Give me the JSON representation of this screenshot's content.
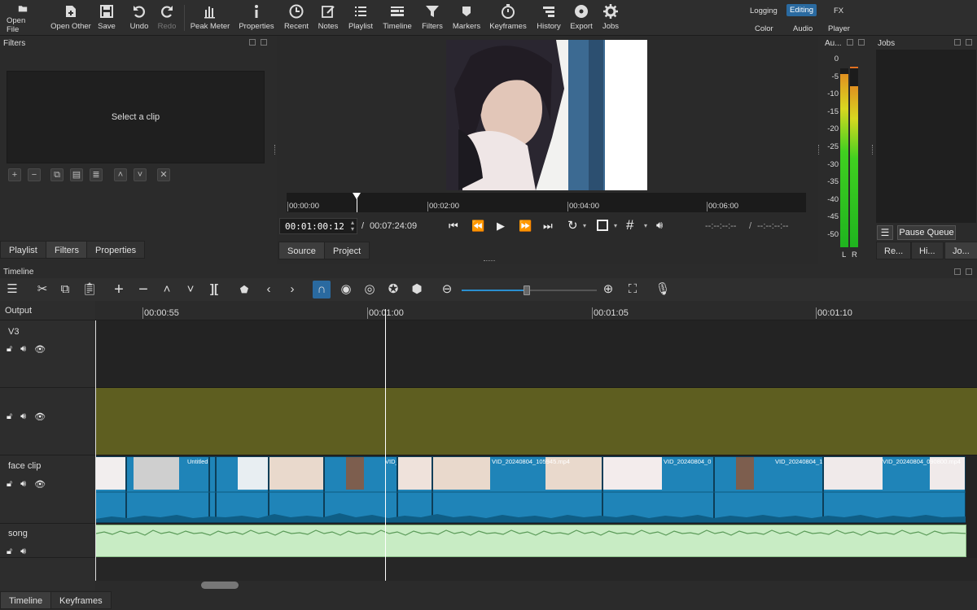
{
  "toolbar": {
    "open_file": "Open File",
    "open_other": "Open Other",
    "save": "Save",
    "undo": "Undo",
    "redo": "Redo",
    "peak_meter": "Peak Meter",
    "properties": "Properties",
    "recent": "Recent",
    "notes": "Notes",
    "playlist": "Playlist",
    "timeline": "Timeline",
    "filters": "Filters",
    "markers": "Markers",
    "keyframes": "Keyframes",
    "history": "History",
    "export": "Export",
    "jobs": "Jobs"
  },
  "layouts": {
    "logging": "Logging",
    "editing": "Editing",
    "fx": "FX",
    "color": "Color",
    "audio": "Audio",
    "player": "Player"
  },
  "filters_panel": {
    "title": "Filters",
    "placeholder": "Select a clip"
  },
  "left_tabs": {
    "playlist": "Playlist",
    "filters": "Filters",
    "properties": "Properties"
  },
  "player": {
    "ruler_labels": [
      "00:00:00",
      "00:02:00",
      "00:04:00",
      "00:06:00"
    ],
    "current_time": "00:01:00:12",
    "separator": "/",
    "total_time": "00:07:24:09",
    "in_point": "--:--:--:--",
    "out_point": "--:--:--:--",
    "tab_source": "Source",
    "tab_project": "Project"
  },
  "audio_meter": {
    "title": "Au...",
    "scale": [
      "0",
      "-5",
      "-10",
      "-15",
      "-20",
      "-25",
      "-30",
      "-35",
      "-40",
      "-45",
      "-50"
    ],
    "left": "L",
    "right": "R",
    "level_left": 0.97,
    "level_right": 0.9
  },
  "jobs_panel": {
    "title": "Jobs",
    "pause_queue": "Pause Queue",
    "tab_recent": "Re...",
    "tab_history": "Hi...",
    "tab_jobs": "Jo..."
  },
  "timeline": {
    "title": "Timeline",
    "output_label": "Output",
    "ruler": [
      "00:00:55",
      "00:01:00",
      "00:01:05",
      "00:01:10"
    ],
    "tracks": [
      {
        "name": "V3"
      },
      {
        "name": ""
      },
      {
        "name": "face clip"
      },
      {
        "name": "song"
      }
    ],
    "clip_labels": [
      "Untitled",
      "VID_",
      "VID_20240804_105945.mp4",
      "VID_20240804_0",
      "VID_20240804_1",
      "VID_20240804_090800.mp4"
    ],
    "zoom_level": 0.48
  },
  "bottom_tabs": {
    "timeline": "Timeline",
    "keyframes": "Keyframes"
  },
  "colors": {
    "accent": "#2a6aa0",
    "clip_blue": "#1f84b8",
    "track_olive": "#5e5e20",
    "audio_green": "#c8ecc4"
  }
}
